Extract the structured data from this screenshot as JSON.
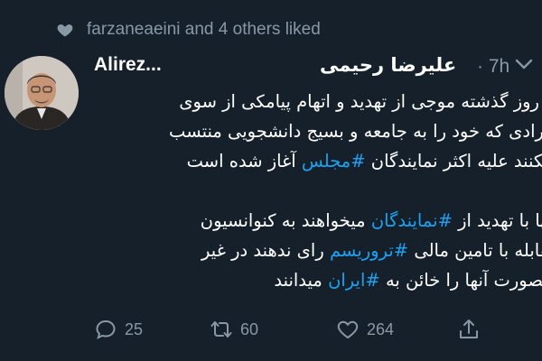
{
  "social_context": {
    "text": "farzaneaeini and 4 others liked",
    "icon": "heart-icon"
  },
  "tweet": {
    "display_name": "Alirez...",
    "persian_name": "علیرضا رحیمی",
    "time": "· 7h",
    "lines": [
      [
        {
          "t": "از روز گذشته موجی از تهدید و اتهام پیامکی از سوی"
        }
      ],
      [
        {
          "t": "افرادی که خود را به جامعه و بسیج دانشجویی منتسب"
        }
      ],
      [
        {
          "t": "میکنند علیه اکثر نمایندگان "
        },
        {
          "t": "#مجلس",
          "h": true
        },
        {
          "t": " آغاز شده است"
        }
      ],
      [],
      [
        {
          "t": "آنها با تهدید از "
        },
        {
          "t": "#نمایندگان",
          "h": true
        },
        {
          "t": " میخواهند به کنوانسیون"
        }
      ],
      [
        {
          "t": "مقابله با تامین مالی "
        },
        {
          "t": "#تروریسم",
          "h": true
        },
        {
          "t": " رای ندهند در غیر"
        }
      ],
      [
        {
          "t": "اینصورت آنها را خائن به "
        },
        {
          "t": "#ایران",
          "h": true
        },
        {
          "t": " میدانند"
        }
      ]
    ]
  },
  "actions": {
    "reply_count": "25",
    "retweet_count": "60",
    "like_count": "264"
  },
  "colors": {
    "background": "#15202b",
    "muted": "#8899a6",
    "hashtag": "#1da1f2"
  }
}
